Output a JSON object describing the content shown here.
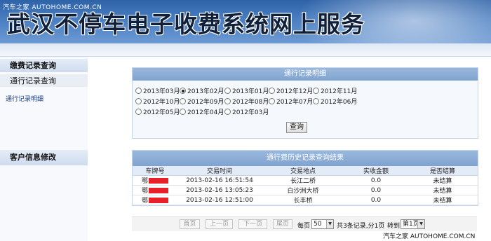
{
  "watermark_top": "汽车之家 AUTOHOME.COM.CN",
  "watermark_bottom": "汽车之家 AUTOHOME.COM.CN",
  "banner_title": "武汉不停车电子收费系统网上服务",
  "sidebar": {
    "payment_records": "缴费记录查询",
    "toll_records": "通行记录查询",
    "toll_detail_link": "通行记录明细",
    "customer_info": "客户信息修改"
  },
  "query_panel": {
    "title": "通行记录明细",
    "months": [
      "2013年03月",
      "2013年02月",
      "2013年01月",
      "2012年12月",
      "2012年11月",
      "2012年10月",
      "2012年09月",
      "2012年08月",
      "2012年07月",
      "2012年06月",
      "2012年05月",
      "2012年04月",
      "2012年03月"
    ],
    "selected_month": "2013年02月",
    "query_button": "查询"
  },
  "results": {
    "title": "通行费历史记录查询结果",
    "columns": [
      "车牌号",
      "交易时间",
      "交易地点",
      "实收金额",
      "是否结算"
    ],
    "rows": [
      {
        "plate": "鄂",
        "time": "2013-02-16 16:51:54",
        "place": "长江二桥",
        "amount": "0.0",
        "settled": "未结算"
      },
      {
        "plate": "鄂",
        "time": "2013-02-16 13:05:23",
        "place": "白沙洲大桥",
        "amount": "0.0",
        "settled": "未结算"
      },
      {
        "plate": "鄂",
        "time": "2013-02-16 12:51:00",
        "place": "长丰桥",
        "amount": "0.0",
        "settled": "未结算"
      }
    ]
  },
  "pager": {
    "first": "首页",
    "prev": "上一页",
    "next": "下一页",
    "last": "尾页",
    "per_page_label": "每页",
    "per_page_value": "50",
    "summary": "共3条记录,分1页",
    "goto_label": "转到",
    "goto_value": "第1页"
  },
  "colors": {
    "banner_dark": "#2f63a8",
    "banner_light": "#6d9ad3",
    "panel_header": "#7fa3d0",
    "redaction": "#e8202a"
  }
}
